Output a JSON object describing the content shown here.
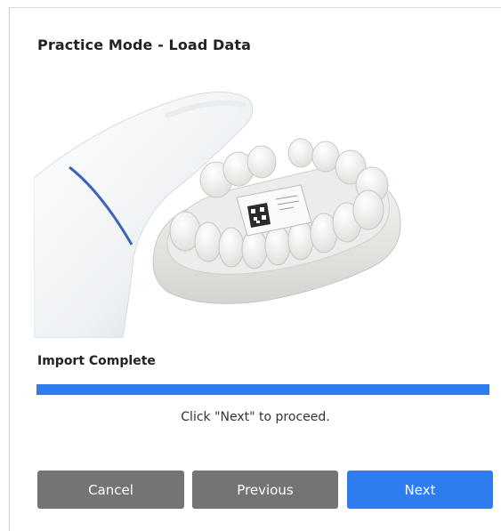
{
  "dialog": {
    "title": "Practice Mode - Load Data"
  },
  "status": {
    "label": "Import Complete",
    "progress": 1.0,
    "hint": "Click \"Next\" to proceed."
  },
  "buttons": {
    "cancel": "Cancel",
    "previous": "Previous",
    "next": "Next"
  },
  "colors": {
    "accent": "#2f7bf0",
    "secondary_button": "#747474"
  },
  "illustration": {
    "icon": "intraoral-scanner-and-dental-model"
  }
}
